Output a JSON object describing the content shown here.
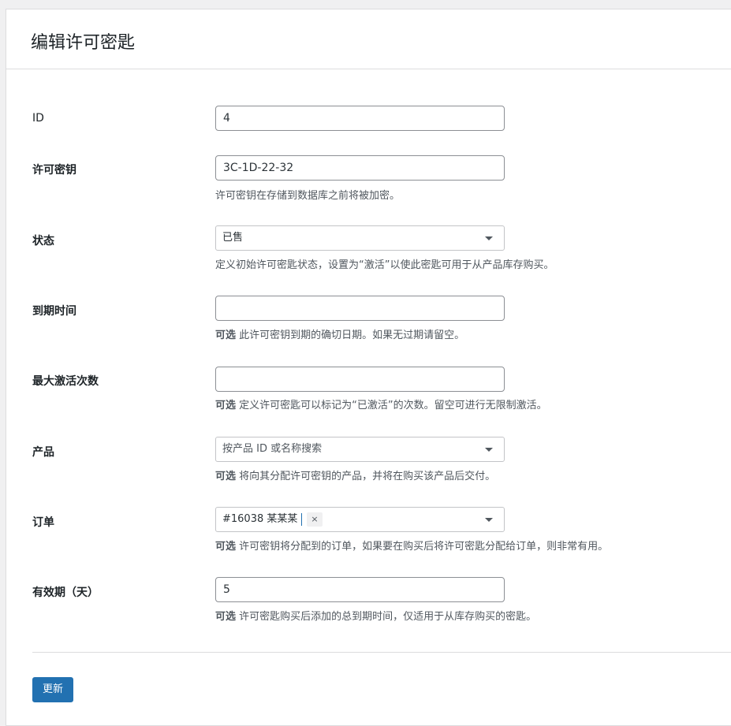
{
  "page": {
    "title": "编辑许可密匙"
  },
  "fields": {
    "id": {
      "label": "ID",
      "value": "4"
    },
    "license_key": {
      "label": "许可密钥",
      "value": "3C-1D-22-32",
      "help": "许可密钥在存储到数据库之前将被加密。"
    },
    "status": {
      "label": "状态",
      "value": "已售",
      "help": "定义初始许可密匙状态，设置为“激活”以使此密匙可用于从产品库存购买。"
    },
    "expires_at": {
      "label": "到期时间",
      "value": "",
      "help_prefix": "可选",
      "help": "此许可密钥到期的确切日期。如果无过期请留空。"
    },
    "max_activations": {
      "label": "最大激活次数",
      "value": "",
      "help_prefix": "可选",
      "help": "定义许可密匙可以标记为“已激活”的次数。留空可进行无限制激活。"
    },
    "product": {
      "label": "产品",
      "placeholder": "按产品 ID 或名称搜索",
      "help_prefix": "可选",
      "help": "将向其分配许可密钥的产品，并将在购买该产品后交付。"
    },
    "order": {
      "label": "订单",
      "selected": "#16038 某某某",
      "remove_symbol": "×",
      "help_prefix": "可选",
      "help": "许可密钥将分配到的订单，如果要在购买后将许可密匙分配给订单，则非常有用。"
    },
    "valid_for": {
      "label": "有效期（天）",
      "value": "5",
      "help_prefix": "可选",
      "help": "许可密匙购买后添加的总到期时间，仅适用于从库存购买的密匙。"
    }
  },
  "actions": {
    "submit_label": "更新"
  },
  "colors": {
    "primary": "#2271b1",
    "border": "#8c8f94",
    "background": "#f0f0f1"
  }
}
